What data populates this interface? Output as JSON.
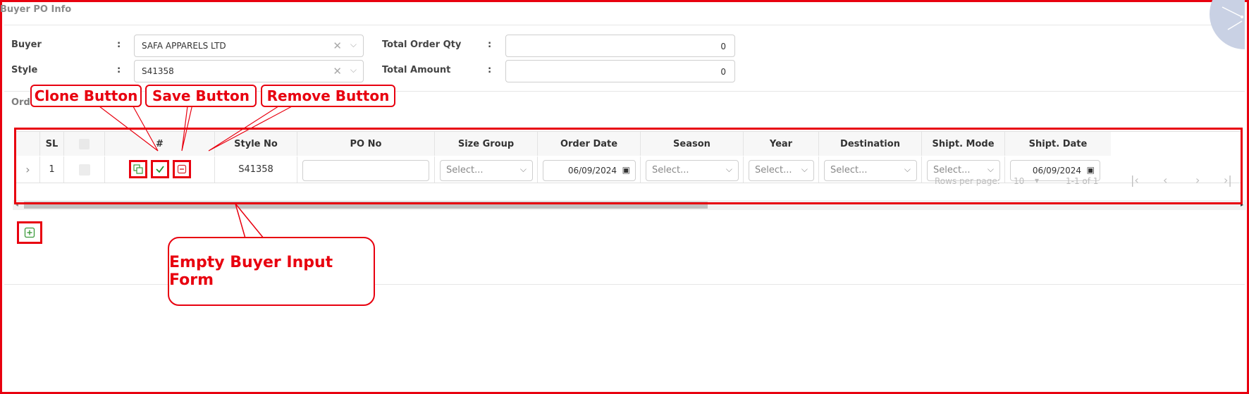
{
  "section_title": "Buyer PO Info",
  "form": {
    "buyer_label": "Buyer",
    "buyer_value": "SAFA APPARELS LTD",
    "style_label": "Style",
    "style_value": "S41358",
    "total_qty_label": "Total Order Qty",
    "total_qty_value": "0",
    "total_amount_label": "Total Amount",
    "total_amount_value": "0",
    "colon": ":"
  },
  "order_details_title": "Order Details",
  "table": {
    "headers": {
      "sl": "SL",
      "actions": "#",
      "style_no": "Style No",
      "po_no": "PO No",
      "size_group": "Size Group",
      "order_date": "Order Date",
      "season": "Season",
      "year": "Year",
      "destination": "Destination",
      "shipt_mode": "Shipt. Mode",
      "shipt_date": "Shipt. Date"
    },
    "row": {
      "sl": "1",
      "style_no": "S41358",
      "size_group": "Select...",
      "order_date": "06/09/2024",
      "season": "Select...",
      "year": "Select...",
      "destination": "Select...",
      "shipt_mode": "Select...",
      "shipt_date": "06/09/2024"
    }
  },
  "pagination": {
    "rows_per_page_label": "Rows per page:",
    "rows_per_page_value": "10",
    "range": "1-1 of 1"
  },
  "annotations": {
    "clone": "Clone Button",
    "save": "Save Button",
    "remove": "Remove Button",
    "empty_form": "Empty Buyer Input Form"
  },
  "colors": {
    "annotation_red": "#e8000f",
    "clone_green": "#3a9a3a",
    "save_green": "#1f8f2f",
    "remove_red": "#d9272e"
  },
  "icons": [
    "expand-chevron-icon",
    "clone-icon",
    "check-icon",
    "minus-icon",
    "add-icon",
    "clear-icon",
    "chevron-down-icon",
    "calendar-icon"
  ]
}
